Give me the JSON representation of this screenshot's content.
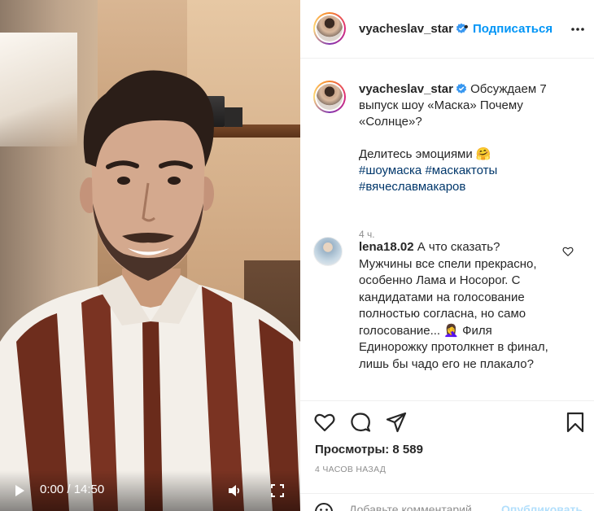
{
  "video": {
    "time": "0:00 / 14:50"
  },
  "header": {
    "username": "vyacheslav_star",
    "separator": "•",
    "follow_label": "Подписаться"
  },
  "caption": {
    "username": "vyacheslav_star",
    "line1": "Обсуждаем 7 выпуск шоу «Маска» Почему «Солнце»?",
    "line2": "Делитесь эмоциями 🤗",
    "hashtag1": "#шоумаска",
    "hashtag2": "#маскактоты",
    "hashtag3": "#вячеславмакаров",
    "time": "4 ч."
  },
  "comment": {
    "username": "lena18.02",
    "text": "А что сказать? Мужчины все спели прекрасно, особенно Лама и Носорог. С кандидатами на голосование полностью согласна, но само голосование... 🤦‍♀️ Филя Единорожку протолкнет в финал, лишь бы чадо его не плакало?"
  },
  "stats": {
    "views": "Просмотры: 8 589",
    "timestamp": "4 ЧАСОВ НАЗАД"
  },
  "composer": {
    "placeholder": "Добавьте комментарий...",
    "publish_label": "Опубликовать"
  },
  "colors": {
    "link_blue": "#0095f6",
    "hashtag": "#00376b",
    "muted": "#8e8e8e",
    "publish_disabled": "#b2dffc"
  },
  "icons": {
    "play": "play-icon",
    "volume": "volume-icon",
    "fullscreen": "fullscreen-icon",
    "verified": "verified-badge-icon",
    "more": "more-icon",
    "heart": "heart-icon",
    "comment": "comment-icon",
    "share": "share-icon",
    "bookmark": "bookmark-icon",
    "emoji": "emoji-icon"
  }
}
